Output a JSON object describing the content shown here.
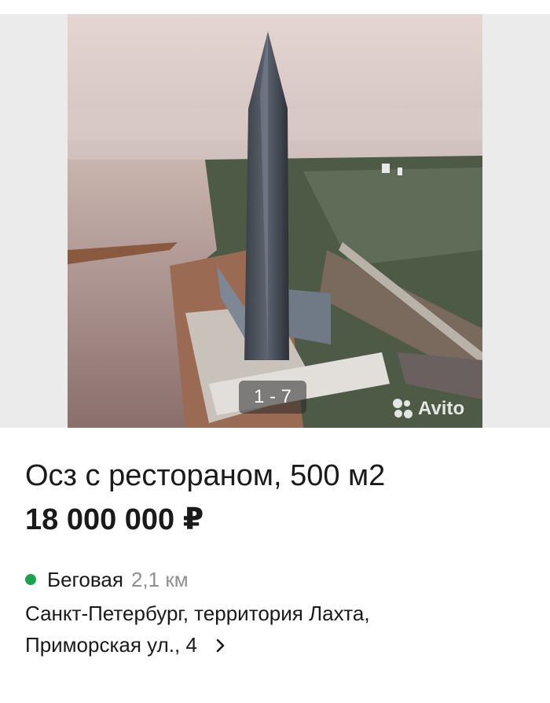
{
  "gallery": {
    "counter": "1 - 7",
    "watermark": "Avito",
    "photo_icon": "lakhta-tower-photo"
  },
  "listing": {
    "title": "Осз с рестораном, 500 м2",
    "price": "18 000 000 ₽",
    "metro": {
      "station": "Беговая",
      "distance": "2,1 км",
      "line_color": "#1ea34a"
    },
    "address_line1": "Санкт-Петербург, территория Лахта,",
    "address_line2": "Приморская ул., 4",
    "chevron_icon": "chevron-right-icon"
  }
}
